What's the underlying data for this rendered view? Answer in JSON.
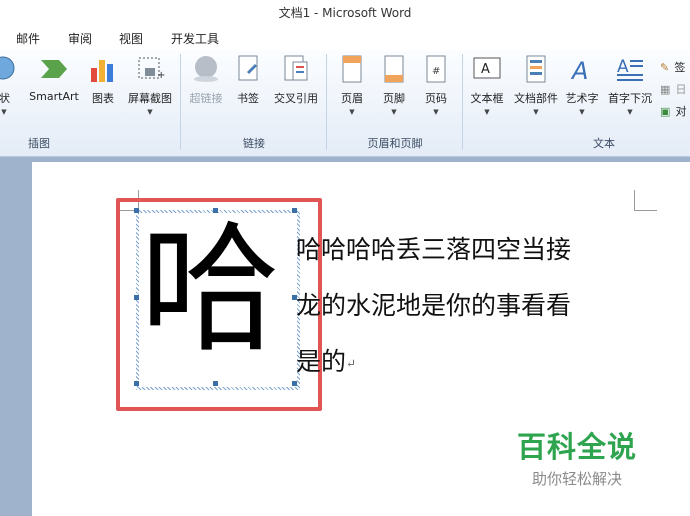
{
  "window": {
    "title": "文档1 - Microsoft Word"
  },
  "menu": {
    "items": [
      "邮件",
      "审阅",
      "视图",
      "开发工具"
    ]
  },
  "ribbon": {
    "groups": [
      {
        "label": "插图",
        "buttons": [
          "形状",
          "SmartArt",
          "图表",
          "屏幕截图"
        ]
      },
      {
        "label": "链接",
        "buttons": [
          "超链接",
          "书签",
          "交叉引用"
        ]
      },
      {
        "label": "页眉和页脚",
        "buttons": [
          "页眉",
          "页脚",
          "页码"
        ]
      },
      {
        "label": "文本",
        "buttons": [
          "文本框",
          "文档部件",
          "艺术字",
          "首字下沉"
        ]
      }
    ],
    "truncated_first_button": "形状",
    "small_buttons": [
      "签",
      "日",
      "对"
    ]
  },
  "document": {
    "dropcap": "哈",
    "lines": [
      "哈哈哈哈丢三落四空当接",
      "龙的水泥地是你的事看看",
      "是的"
    ],
    "paragraph_mark": "↵"
  },
  "watermark": {
    "main": "百科全说",
    "sub": "助你轻松解决"
  }
}
